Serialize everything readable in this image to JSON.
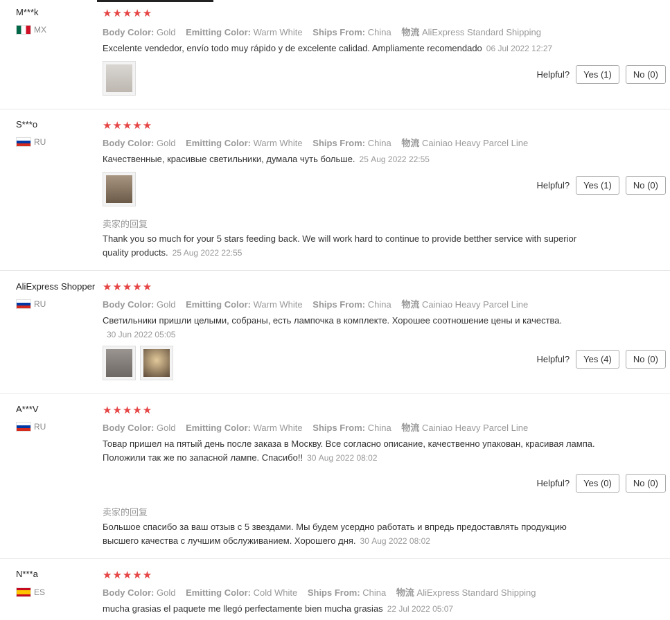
{
  "stars": "★★★★★",
  "helpful_label": "Helpful?",
  "attr_labels": {
    "body_color": "Body Color:",
    "emitting_color": "Emitting Color:",
    "ships_from": "Ships From:",
    "logistics": "物流"
  },
  "reply_title": "卖家的回复",
  "reviews": [
    {
      "user": "M***k",
      "country": "MX",
      "body_color": "Gold",
      "emitting_color": "Warm White",
      "ships_from": "China",
      "logistics": "AliExpress Standard Shipping",
      "text": "Excelente vendedor, envío todo muy rápido y de excelente calidad. Ampliamente recomendado",
      "date": "06 Jul 2022 12:27",
      "yes": "Yes (1)",
      "no": "No (0)"
    },
    {
      "user": "S***o",
      "country": "RU",
      "body_color": "Gold",
      "emitting_color": "Warm White",
      "ships_from": "China",
      "logistics": "Cainiao Heavy Parcel Line",
      "text": "Качественные, красивые светильники, думала чуть больше.",
      "date": "25 Aug 2022 22:55",
      "yes": "Yes (1)",
      "no": "No (0)",
      "reply_text": "Thank you so much for your 5 stars feeding back. We will work hard to continue to provide betther service with superior quality products.",
      "reply_date": "25 Aug 2022 22:55"
    },
    {
      "user": "AliExpress Shopper",
      "country": "RU",
      "body_color": "Gold",
      "emitting_color": "Warm White",
      "ships_from": "China",
      "logistics": "Cainiao Heavy Parcel Line",
      "text": "Светильники пришли целыми, собраны, есть лампочка в комплекте. Хорошее соотношение цены и качества.",
      "date": "30 Jun 2022 05:05",
      "yes": "Yes (4)",
      "no": "No (0)"
    },
    {
      "user": "A***V",
      "country": "RU",
      "body_color": "Gold",
      "emitting_color": "Warm White",
      "ships_from": "China",
      "logistics": "Cainiao Heavy Parcel Line",
      "text": "Товар пришел на пятый день после заказа в Москву. Все согласно описание, качественно упакован, красивая лампа. Положили так же по запасной лампе. Спасибо!!",
      "date": "30 Aug 2022 08:02",
      "yes": "Yes (0)",
      "no": "No (0)",
      "reply_text": "Большое спасибо за ваш отзыв с 5 звездами. Мы будем усердно работать и впредь предоставлять продукцию высшего качества с лучшим обслуживанием. Хорошего дня.",
      "reply_date": "30 Aug 2022 08:02"
    },
    {
      "user": "N***a",
      "country": "ES",
      "body_color": "Gold",
      "emitting_color": "Cold White",
      "ships_from": "China",
      "logistics": "AliExpress Standard Shipping",
      "text": "mucha grasias el paquete me llegó perfectamente bien mucha grasias",
      "date": "22 Jul 2022 05:07"
    }
  ]
}
